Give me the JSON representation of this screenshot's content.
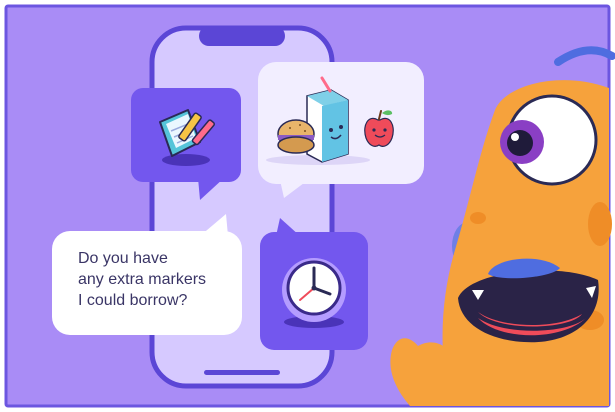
{
  "speech_bubble": {
    "lines": [
      "Do you have",
      "any extra markers",
      "I could borrow?"
    ]
  },
  "icons": {
    "notebook": "notebook-pencil-icon",
    "lunch": "lunch-food-icon",
    "clock": "clock-icon"
  },
  "colors": {
    "background": "#a98cf6",
    "frame_border": "#6c56e0",
    "phone_screen": "#d6c9ff",
    "phone_outline": "#5b46d6",
    "tile_purple": "#7357ee",
    "bubble_white": "#ffffff",
    "bubble_lavender": "#f2eeff",
    "monster_orange": "#f6a23c",
    "monster_spots": "#ef8d27",
    "text_dark": "#3a3566"
  }
}
